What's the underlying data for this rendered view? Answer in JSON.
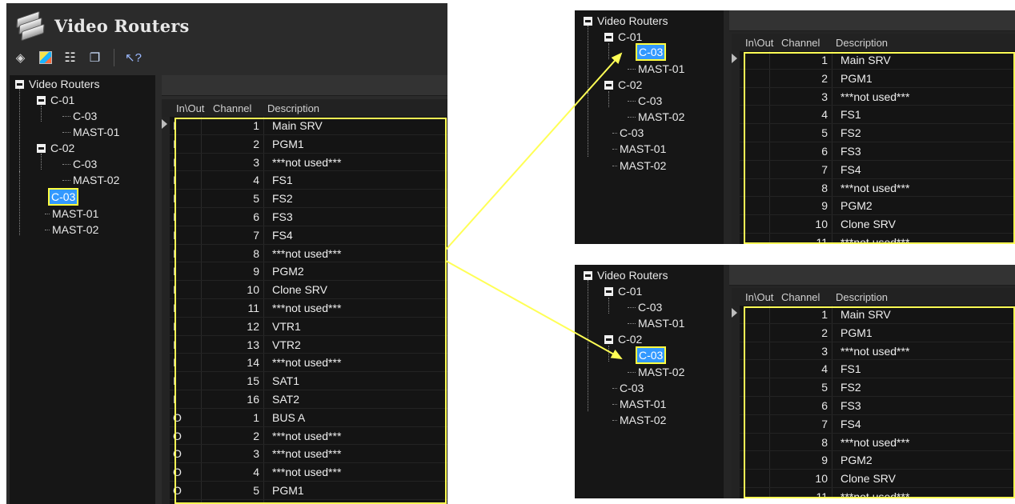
{
  "app": {
    "title": "Video Routers"
  },
  "toolbar": {
    "icons": [
      "router-icon",
      "grid-icon",
      "tree-icon",
      "copy-icon",
      "help-cursor-icon"
    ]
  },
  "tree": {
    "root": "Video Routers",
    "c01": "C-01",
    "c01_children": [
      "C-03",
      "MAST-01"
    ],
    "c02": "C-02",
    "c02_children": [
      "C-03",
      "MAST-02"
    ],
    "top_level": [
      "C-03",
      "MAST-01",
      "MAST-02"
    ]
  },
  "grid": {
    "columns": {
      "io": "In\\Out",
      "channel": "Channel",
      "description": "Description"
    },
    "rows": [
      {
        "io": "I",
        "channel": "1",
        "description": "Main SRV"
      },
      {
        "io": "I",
        "channel": "2",
        "description": "PGM1"
      },
      {
        "io": "I",
        "channel": "3",
        "description": "***not used***"
      },
      {
        "io": "I",
        "channel": "4",
        "description": "FS1"
      },
      {
        "io": "I",
        "channel": "5",
        "description": "FS2"
      },
      {
        "io": "I",
        "channel": "6",
        "description": "FS3"
      },
      {
        "io": "I",
        "channel": "7",
        "description": "FS4"
      },
      {
        "io": "I",
        "channel": "8",
        "description": "***not used***"
      },
      {
        "io": "I",
        "channel": "9",
        "description": "PGM2"
      },
      {
        "io": "I",
        "channel": "10",
        "description": "Clone SRV"
      },
      {
        "io": "I",
        "channel": "11",
        "description": "***not used***"
      },
      {
        "io": "I",
        "channel": "12",
        "description": "VTR1"
      },
      {
        "io": "I",
        "channel": "13",
        "description": "VTR2"
      },
      {
        "io": "I",
        "channel": "14",
        "description": "***not used***"
      },
      {
        "io": "I",
        "channel": "15",
        "description": "SAT1"
      },
      {
        "io": "I",
        "channel": "16",
        "description": "SAT2"
      },
      {
        "io": "O",
        "channel": "1",
        "description": "BUS A"
      },
      {
        "io": "O",
        "channel": "2",
        "description": "***not used***"
      },
      {
        "io": "O",
        "channel": "3",
        "description": "***not used***"
      },
      {
        "io": "O",
        "channel": "4",
        "description": "***not used***"
      },
      {
        "io": "O",
        "channel": "5",
        "description": "PGM1"
      }
    ]
  },
  "colors": {
    "highlight": "#ffff55",
    "selection": "#3399ff"
  }
}
